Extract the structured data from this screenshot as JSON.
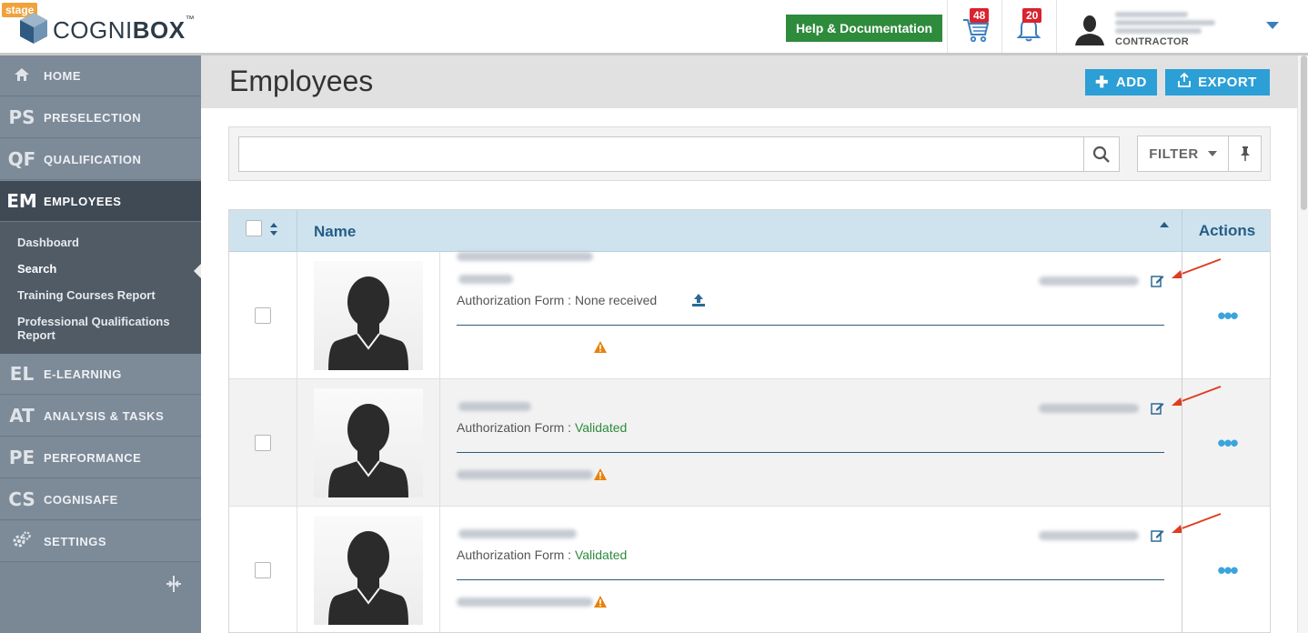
{
  "app": {
    "stage_label": "stage",
    "logo_thin": "COGNI",
    "logo_bold": "BOX",
    "logo_tm": "™"
  },
  "topbar": {
    "help_label": "Help & Documentation",
    "cart_count": "48",
    "notification_count": "20",
    "user_role": "CONTRACTOR"
  },
  "sidebar": {
    "items": [
      {
        "abbr": "",
        "label": "HOME"
      },
      {
        "abbr": "PS",
        "label": "PRESELECTION"
      },
      {
        "abbr": "QF",
        "label": "QUALIFICATION"
      },
      {
        "abbr": "EM",
        "label": "EMPLOYEES"
      },
      {
        "abbr": "EL",
        "label": "E-LEARNING"
      },
      {
        "abbr": "AT",
        "label": "ANALYSIS & TASKS"
      },
      {
        "abbr": "PE",
        "label": "PERFORMANCE"
      },
      {
        "abbr": "CS",
        "label": "COGNISAFE"
      },
      {
        "abbr": "",
        "label": "SETTINGS"
      }
    ],
    "subitems": [
      {
        "label": "Dashboard"
      },
      {
        "label": "Search"
      },
      {
        "label": "Training Courses Report"
      },
      {
        "label": "Professional Qualifications Report"
      }
    ]
  },
  "page": {
    "title": "Employees",
    "add_label": "ADD",
    "export_label": "EXPORT"
  },
  "search": {
    "value": "",
    "placeholder": "",
    "filter_label": "FILTER"
  },
  "table": {
    "columns": {
      "name": "Name",
      "actions": "Actions"
    },
    "rows": [
      {
        "auth_label": "Authorization Form : ",
        "auth_value": "None received",
        "auth_status": "none"
      },
      {
        "auth_label": "Authorization Form : ",
        "auth_value": "Validated",
        "auth_status": "validated"
      },
      {
        "auth_label": "Authorization Form : ",
        "auth_value": "Validated",
        "auth_status": "validated"
      }
    ],
    "actions_glyph": "•••"
  },
  "colors": {
    "help_button": "#2e8b3c",
    "primary_button": "#2b9fd6",
    "badge": "#d9232e",
    "validated": "#2e8b3c",
    "warning": "#e8820c",
    "arrow": "#e03c20"
  },
  "icons": {
    "cart": "cart-icon",
    "notifications": "bell-icon",
    "search": "search-icon",
    "pin": "pin-icon",
    "upload": "upload-icon",
    "edit": "edit-icon",
    "warning": "warning-icon"
  }
}
